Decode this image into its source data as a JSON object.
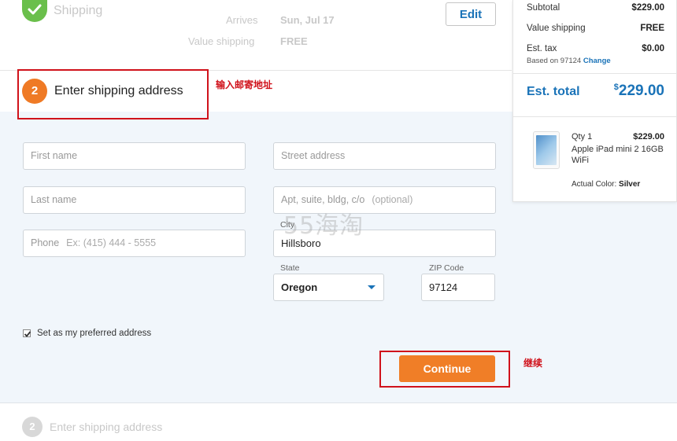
{
  "completed_step": {
    "title": "Shipping",
    "arrives_label": "Arrives",
    "arrives_value": "Sun, Jul 17",
    "value_shipping_label": "Value shipping",
    "value_shipping_value": "FREE",
    "edit_label": "Edit"
  },
  "active_step": {
    "number": "2",
    "title": "Enter shipping address",
    "annotation": "输入邮寄地址"
  },
  "form": {
    "first_name_placeholder": "First name",
    "last_name_placeholder": "Last name",
    "phone_placeholder": "Phone",
    "phone_hint": "Ex: (415) 444 - 5555",
    "street_placeholder": "Street address",
    "apt_placeholder": "Apt, suite, bldg, c/o",
    "apt_hint": "(optional)",
    "city_label": "City",
    "city_value": "Hillsboro",
    "state_label": "State",
    "state_value": "Oregon",
    "zip_label": "ZIP Code",
    "zip_value": "97124",
    "preferred_label": "Set as my preferred address",
    "preferred_checked": true,
    "continue_label": "Continue",
    "continue_annotation": "继续"
  },
  "watermark": "55海淘",
  "next_step": {
    "number": "2",
    "title": "Enter shipping address"
  },
  "summary": {
    "subtotal_label": "Subtotal",
    "subtotal_value": "$229.00",
    "value_shipping_label": "Value shipping",
    "value_shipping_value": "FREE",
    "est_tax_label": "Est. tax",
    "est_tax_value": "$0.00",
    "based_on": "Based on 97124",
    "change_label": "Change",
    "total_label": "Est. total",
    "total_currency": "$",
    "total_value": "229.00",
    "item": {
      "qty": "Qty 1",
      "price": "$229.00",
      "name": "Apple iPad mini 2 16GB WiFi",
      "color_label": "Actual Color:",
      "color_value": "Silver"
    }
  },
  "colors": {
    "accent_orange": "#f07e27",
    "link_blue": "#1a73b8",
    "success_green": "#6abf4b",
    "annotation_red": "#d0121b"
  }
}
